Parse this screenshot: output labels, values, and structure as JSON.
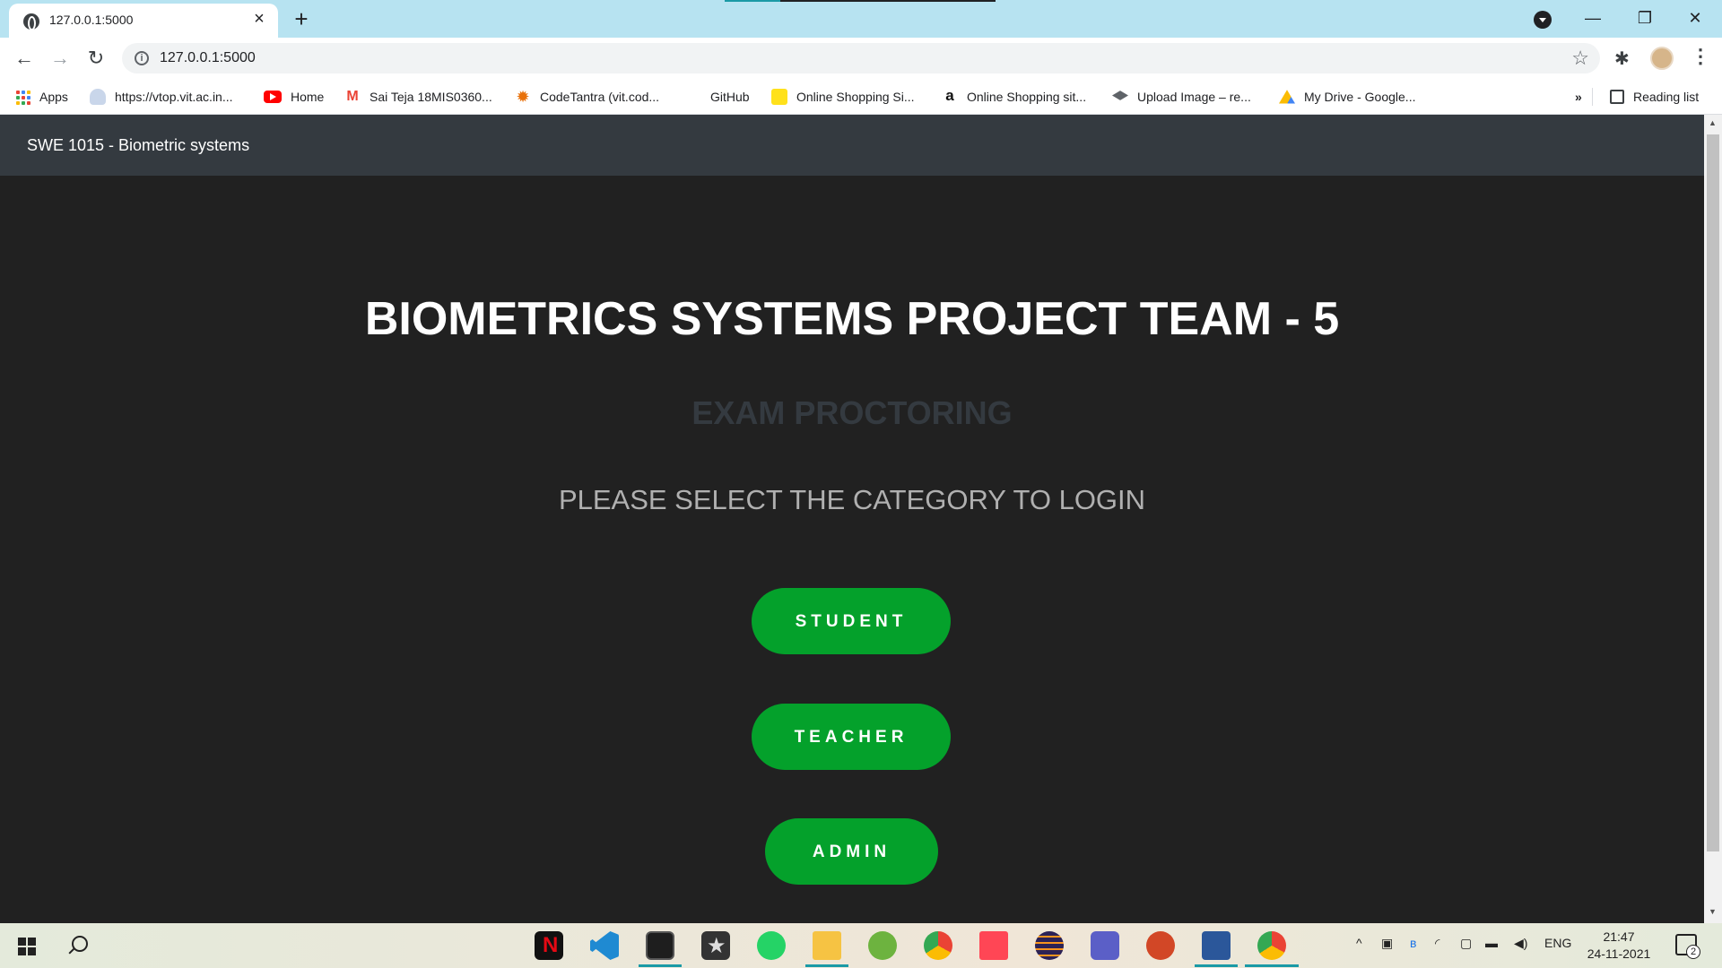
{
  "browser": {
    "tab_title": "127.0.0.1:5000",
    "url": "127.0.0.1:5000",
    "window_controls": {
      "minimize": "—",
      "restore": "❐",
      "close": "✕"
    }
  },
  "bookmarks": [
    {
      "label": "Apps",
      "icon": "apps-grid-icon"
    },
    {
      "label": "https://vtop.vit.ac.in...",
      "icon": "vtop-icon"
    },
    {
      "label": "Home",
      "icon": "youtube-icon"
    },
    {
      "label": "Sai Teja 18MIS0360...",
      "icon": "gmail-icon"
    },
    {
      "label": "CodeTantra (vit.cod...",
      "icon": "codetantra-icon"
    },
    {
      "label": "GitHub",
      "icon": "none"
    },
    {
      "label": "Online Shopping Si...",
      "icon": "flipkart-icon"
    },
    {
      "label": "Online Shopping sit...",
      "icon": "amazon-icon"
    },
    {
      "label": "Upload Image – re...",
      "icon": "upload-icon"
    },
    {
      "label": "My Drive - Google...",
      "icon": "google-drive-icon"
    }
  ],
  "bookmarks_overflow": "»",
  "reading_list": "Reading list",
  "page": {
    "brand": "SWE 1015 - Biometric systems",
    "title": "BIOMETRICS SYSTEMS PROJECT TEAM - 5",
    "subtitle": "EXAM PROCTORING",
    "prompt": "PLEASE SELECT THE CATEGORY TO LOGIN",
    "buttons": {
      "student": "STUDENT",
      "teacher": "TEACHER",
      "admin": "ADMIN"
    }
  },
  "taskbar": {
    "apps": [
      "netflix-icon",
      "vscode-icon",
      "terminal-icon",
      "inkscape-icon",
      "whatsapp-icon",
      "file-explorer-icon",
      "spring-icon",
      "chrome-icon",
      "valorant-icon",
      "eclipse-icon",
      "teams-icon",
      "powerpoint-icon",
      "word-icon",
      "chrome-icon"
    ],
    "language": "ENG",
    "time": "21:47",
    "date": "24-11-2021",
    "notification_count": "2"
  },
  "colors": {
    "navbar": "#343a40",
    "page_background": "#212121",
    "button": "#04a12b",
    "subtitle": "#343a40",
    "tab_strip": "#b7e3f1"
  }
}
